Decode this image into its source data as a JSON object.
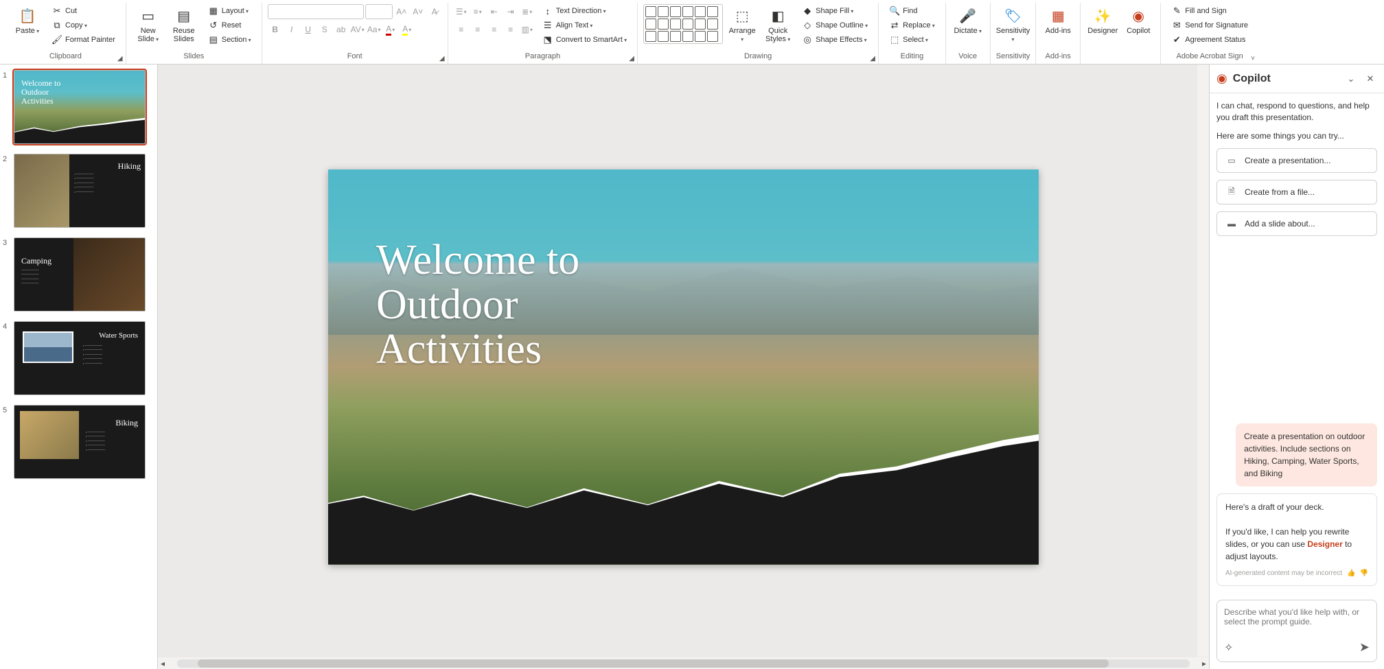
{
  "ribbon": {
    "clipboard": {
      "label": "Clipboard",
      "paste": "Paste",
      "cut": "Cut",
      "copy": "Copy",
      "format_painter": "Format Painter"
    },
    "slides": {
      "label": "Slides",
      "new_slide": "New Slide",
      "reuse_slides": "Reuse Slides",
      "layout": "Layout",
      "reset": "Reset",
      "section": "Section"
    },
    "font": {
      "label": "Font",
      "name_placeholder": "",
      "size_placeholder": ""
    },
    "paragraph": {
      "label": "Paragraph",
      "text_direction": "Text Direction",
      "align_text": "Align Text",
      "convert_smartart": "Convert to SmartArt"
    },
    "drawing": {
      "label": "Drawing",
      "arrange": "Arrange",
      "quick_styles": "Quick Styles",
      "shape_fill": "Shape Fill",
      "shape_outline": "Shape Outline",
      "shape_effects": "Shape Effects"
    },
    "editing": {
      "label": "Editing",
      "find": "Find",
      "replace": "Replace",
      "select": "Select"
    },
    "voice": {
      "label": "Voice",
      "dictate": "Dictate"
    },
    "sensitivity": {
      "label": "Sensitivity",
      "btn": "Sensitivity"
    },
    "addins": {
      "label": "Add-ins",
      "btn": "Add-ins"
    },
    "designer": "Designer",
    "copilot": "Copilot",
    "acrobat": {
      "label": "Adobe Acrobat Sign",
      "fill_sign": "Fill and Sign",
      "send_sig": "Send for Signature",
      "agreement": "Agreement Status"
    }
  },
  "thumbnails": [
    {
      "num": "1",
      "title": "Welcome to Outdoor Activities"
    },
    {
      "num": "2",
      "title": "Hiking"
    },
    {
      "num": "3",
      "title": "Camping"
    },
    {
      "num": "4",
      "title": "Water Sports"
    },
    {
      "num": "5",
      "title": "Biking"
    }
  ],
  "slide": {
    "title_line1": "Welcome to",
    "title_line2": "Outdoor",
    "title_line3": "Activities"
  },
  "copilot": {
    "title": "Copilot",
    "intro": "I can chat, respond to questions, and help you draft this presentation.",
    "try_label": "Here are some things you can try...",
    "suggestions": [
      "Create a presentation...",
      "Create from a file...",
      "Add a slide about..."
    ],
    "user_msg": "Create a presentation on outdoor activities. Include sections on Hiking, Camping, Water Sports, and Biking",
    "bot_line1": "Here's a draft of your deck.",
    "bot_line2a": "If you'd like, I can help you rewrite slides, or you can use ",
    "bot_designer": "Designer",
    "bot_line2b": " to adjust layouts.",
    "disclaimer": "AI-generated content may be incorrect",
    "input_placeholder": "Describe what you'd like help with, or select the prompt guide."
  }
}
